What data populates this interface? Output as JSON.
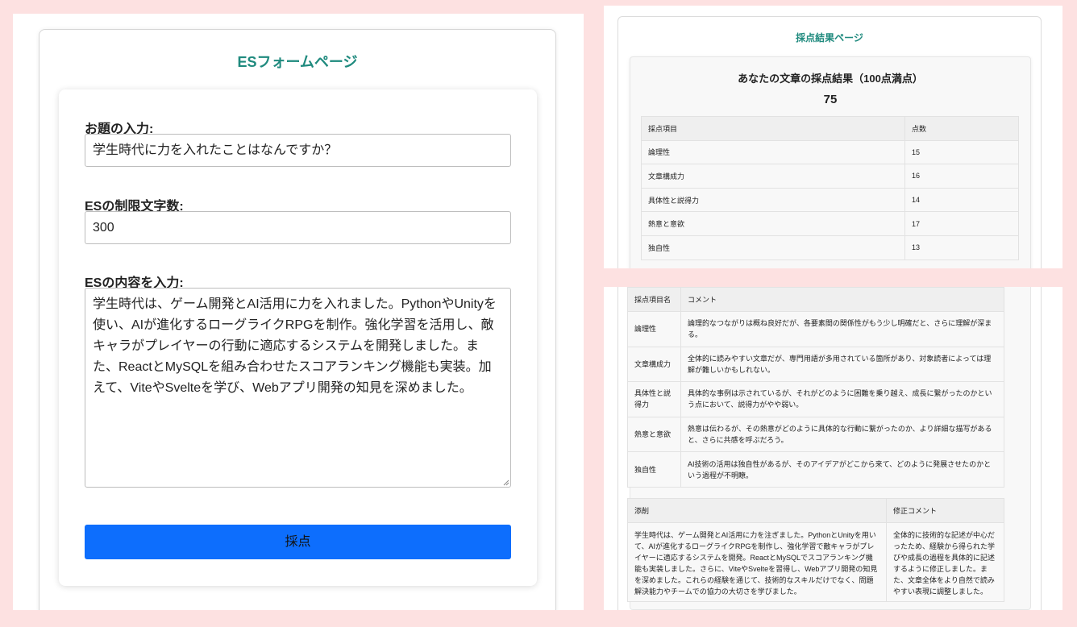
{
  "form_page": {
    "title": "ESフォームページ",
    "topic_label": "お題の入力:",
    "topic_value": "学生時代に力を入れたことはなんですか？",
    "limit_label": "ESの制限文字数:",
    "limit_value": "300",
    "content_label": "ESの内容を入力:",
    "content_value": "学生時代は、ゲーム開発とAI活用に力を入れました。PythonやUnityを使い、AIが進化するローグライクRPGを制作。強化学習を活用し、敵キャラがプレイヤーの行動に適応するシステムを開発しました。また、ReactとMySQLを組み合わせたスコアランキング機能も実装。加えて、ViteやSvelteを学び、Webアプリ開発の知見を深めました。",
    "submit_label": "採点"
  },
  "result_page": {
    "title": "採点結果ページ",
    "heading": "あなたの文章の採点結果（100点満点）",
    "total_score": "75",
    "score_table": {
      "headers": [
        "採点項目",
        "点数"
      ],
      "rows": [
        {
          "item": "論理性",
          "score": "15"
        },
        {
          "item": "文章構成力",
          "score": "16"
        },
        {
          "item": "具体性と説得力",
          "score": "14"
        },
        {
          "item": "熱意と意欲",
          "score": "17"
        },
        {
          "item": "独自性",
          "score": "13"
        }
      ]
    },
    "comment_table": {
      "headers": [
        "採点項目名",
        "コメント"
      ],
      "rows": [
        {
          "item": "論理性",
          "comment": "論理的なつながりは概ね良好だが、各要素間の関係性がもう少し明確だと、さらに理解が深まる。"
        },
        {
          "item": "文章構成力",
          "comment": "全体的に読みやすい文章だが、専門用語が多用されている箇所があり、対象読者によっては理解が難しいかもしれない。"
        },
        {
          "item": "具体性と説得力",
          "comment": "具体的な事例は示されているが、それがどのように困難を乗り越え、成長に繋がったのかという点において、説得力がやや弱い。"
        },
        {
          "item": "熱意と意欲",
          "comment": "熱意は伝わるが、その熱意がどのように具体的な行動に繋がったのか、より詳細な描写があると、さらに共感を呼ぶだろう。"
        },
        {
          "item": "独自性",
          "comment": "AI技術の活用は独自性があるが、そのアイデアがどこから来て、どのように発展させたのかという過程が不明瞭。"
        }
      ]
    },
    "revision_table": {
      "headers": [
        "添削",
        "修正コメント"
      ],
      "revised_text": "学生時代は、ゲーム開発とAI活用に力を注ぎました。PythonとUnityを用いて、AIが進化するローグライクRPGを制作し、強化学習で敵キャラがプレイヤーに適応するシステムを開発。ReactとMySQLでスコアランキング機能も実装しました。さらに、ViteやSvelteを習得し、Webアプリ開発の知見を深めました。これらの経験を通じて、技術的なスキルだけでなく、問題解決能力やチームでの協力の大切さを学びました。",
      "revision_comment": "全体的に技術的な記述が中心だったため、経験から得られた学びや成長の過程を具体的に記述するように修正しました。また、文章全体をより自然で読みやすい表現に調整しました。"
    }
  },
  "colors": {
    "background": "#fde1e1",
    "title_accent": "#1f8a7e",
    "submit_button": "#0d6efd"
  },
  "icons": {
    "textarea_resize": "resize-grip-icon"
  }
}
